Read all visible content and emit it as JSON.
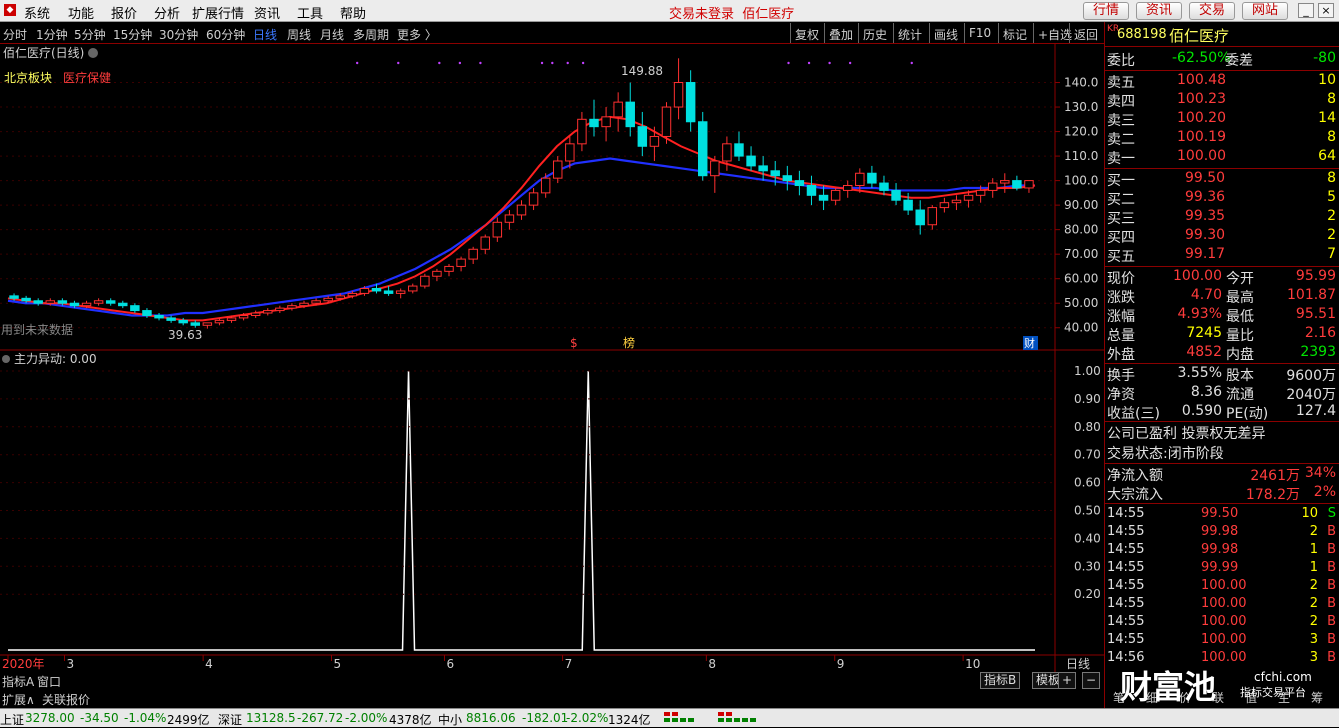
{
  "menubar": {
    "items": [
      "系统",
      "功能",
      "报价",
      "分析",
      "扩展行情",
      "资讯",
      "工具",
      "帮助"
    ],
    "status": "交易未登录",
    "stock_name": "佰仁医疗",
    "buttons": [
      "行情",
      "资讯",
      "交易",
      "网站"
    ]
  },
  "periodbar": {
    "periods": [
      "分时",
      "1分钟",
      "5分钟",
      "15分钟",
      "30分钟",
      "60分钟",
      "日线",
      "周线",
      "月线",
      "多周期",
      "更多 〉"
    ],
    "active": "日线",
    "right": [
      "复权",
      "叠加",
      "历史",
      "统计",
      "画线",
      "F10",
      "标记",
      "+自选",
      "返回"
    ]
  },
  "chart": {
    "title": "佰仁医疗(日线)",
    "sector": "北京板块",
    "sector_tag": "医疗保健",
    "overlay_text": "用到未来数据",
    "high_label": "149.88",
    "low_label": "39.63",
    "event_markers": [
      "$",
      "榜",
      "财"
    ],
    "price_axis": [
      "140.0",
      "130.0",
      "120.0",
      "110.0",
      "100.0",
      "90.00",
      "80.00",
      "70.00",
      "60.00",
      "50.00",
      "40.00"
    ],
    "indicator": {
      "title": "主力异动",
      "value_label": "主力异动: 0.00",
      "axis": [
        "1.00",
        "0.90",
        "0.80",
        "0.70",
        "0.60",
        "0.50",
        "0.40",
        "0.30",
        "0.20"
      ]
    },
    "date_labels": [
      "2020年",
      "3",
      "4",
      "5",
      "6",
      "7",
      "8",
      "9",
      "10"
    ],
    "period_tag": "日线"
  },
  "chart_data": {
    "type": "candlestick",
    "title": "佰仁医疗(日线)",
    "price_range": [
      35,
      150
    ],
    "candles": [
      [
        53,
        54,
        51,
        52
      ],
      [
        52,
        53,
        50,
        51
      ],
      [
        51,
        52,
        49,
        50
      ],
      [
        50,
        52,
        49,
        51
      ],
      [
        51,
        52,
        49,
        50
      ],
      [
        50,
        51,
        48,
        49
      ],
      [
        49,
        51,
        48,
        50
      ],
      [
        50,
        52,
        49,
        51
      ],
      [
        51,
        52,
        49,
        50
      ],
      [
        50,
        51,
        48,
        49
      ],
      [
        49,
        50,
        46,
        47
      ],
      [
        47,
        48,
        44,
        45
      ],
      [
        45,
        46,
        43,
        44
      ],
      [
        44,
        45,
        42,
        43
      ],
      [
        43,
        44,
        41,
        42
      ],
      [
        42,
        43,
        40,
        41
      ],
      [
        41,
        42,
        39.63,
        42
      ],
      [
        42,
        44,
        41,
        43
      ],
      [
        43,
        45,
        42,
        44
      ],
      [
        44,
        46,
        43,
        45
      ],
      [
        45,
        47,
        44,
        46
      ],
      [
        46,
        48,
        45,
        47
      ],
      [
        47,
        49,
        46,
        48
      ],
      [
        48,
        50,
        47,
        49
      ],
      [
        49,
        51,
        48,
        50
      ],
      [
        50,
        52,
        49,
        51
      ],
      [
        51,
        53,
        50,
        52
      ],
      [
        52,
        54,
        51,
        53
      ],
      [
        53,
        55,
        52,
        54
      ],
      [
        54,
        57,
        53,
        56
      ],
      [
        56,
        58,
        54,
        55
      ],
      [
        55,
        57,
        53,
        54
      ],
      [
        54,
        56,
        52,
        55
      ],
      [
        55,
        58,
        54,
        57
      ],
      [
        57,
        62,
        56,
        61
      ],
      [
        61,
        64,
        59,
        63
      ],
      [
        63,
        66,
        61,
        65
      ],
      [
        65,
        69,
        63,
        68
      ],
      [
        68,
        73,
        66,
        72
      ],
      [
        72,
        78,
        70,
        77
      ],
      [
        77,
        85,
        75,
        83
      ],
      [
        83,
        88,
        80,
        86
      ],
      [
        86,
        92,
        84,
        90
      ],
      [
        90,
        97,
        88,
        95
      ],
      [
        95,
        103,
        93,
        101
      ],
      [
        101,
        110,
        99,
        108
      ],
      [
        108,
        118,
        105,
        115
      ],
      [
        115,
        128,
        112,
        125
      ],
      [
        125,
        133,
        118,
        122
      ],
      [
        122,
        130,
        116,
        126
      ],
      [
        126,
        136,
        120,
        132
      ],
      [
        132,
        140,
        118,
        122
      ],
      [
        122,
        128,
        110,
        114
      ],
      [
        114,
        122,
        108,
        118
      ],
      [
        118,
        132,
        115,
        130
      ],
      [
        130,
        149.88,
        125,
        140
      ],
      [
        140,
        145,
        120,
        124
      ],
      [
        124,
        128,
        100,
        102
      ],
      [
        102,
        110,
        95,
        108
      ],
      [
        108,
        118,
        104,
        115
      ],
      [
        115,
        120,
        108,
        110
      ],
      [
        110,
        114,
        104,
        106
      ],
      [
        106,
        110,
        100,
        104
      ],
      [
        104,
        108,
        98,
        102
      ],
      [
        102,
        106,
        96,
        100
      ],
      [
        100,
        104,
        94,
        98
      ],
      [
        98,
        102,
        90,
        94
      ],
      [
        94,
        98,
        88,
        92
      ],
      [
        92,
        97,
        90,
        96
      ],
      [
        96,
        100,
        93,
        98
      ],
      [
        98,
        105,
        95,
        103
      ],
      [
        103,
        106,
        97,
        99
      ],
      [
        99,
        102,
        94,
        96
      ],
      [
        96,
        99,
        90,
        92
      ],
      [
        92,
        95,
        86,
        88
      ],
      [
        88,
        92,
        78,
        82
      ],
      [
        82,
        90,
        80,
        89
      ],
      [
        89,
        93,
        87,
        91
      ],
      [
        91,
        94,
        88,
        92
      ],
      [
        92,
        96,
        89,
        94
      ],
      [
        94,
        98,
        91,
        96
      ],
      [
        96,
        101,
        93,
        99
      ],
      [
        99,
        103,
        95,
        100
      ],
      [
        100,
        102,
        96,
        97
      ],
      [
        97,
        100,
        95,
        100
      ]
    ],
    "ma_short": [
      52,
      51,
      50,
      50,
      49,
      48,
      47,
      46,
      45,
      44,
      43,
      43,
      44,
      45,
      46,
      47,
      48,
      49,
      50,
      52,
      54,
      56,
      58,
      61,
      65,
      70,
      76,
      82,
      89,
      97,
      106,
      114,
      120,
      124,
      126,
      125,
      122,
      118,
      114,
      111,
      108,
      106,
      104,
      102,
      100,
      99,
      98,
      97,
      96,
      95,
      94,
      93,
      93,
      94,
      95,
      96,
      97,
      97,
      98
    ],
    "ma_long": [
      51,
      50,
      50,
      49,
      48,
      47,
      46,
      45,
      45,
      45,
      46,
      46,
      47,
      48,
      49,
      50,
      51,
      52,
      53,
      54,
      56,
      58,
      61,
      64,
      68,
      72,
      77,
      82,
      88,
      94,
      100,
      104,
      107,
      108,
      109,
      108,
      107,
      106,
      105,
      104,
      103,
      102,
      101,
      100,
      99,
      98,
      97,
      97,
      97,
      97,
      96,
      96,
      96,
      96,
      97,
      97,
      97,
      98,
      98
    ],
    "indicator_values": {
      "name": "主力异动",
      "spikes_at_date_fraction": [
        0.39,
        0.565
      ],
      "range": [
        0,
        1
      ]
    }
  },
  "bottombar": {
    "tabs": [
      "指标A",
      "窗口",
      "扩展∧",
      "关联报价"
    ],
    "right_tabs": [
      "指标B",
      "模板",
      "+",
      "−"
    ]
  },
  "statusbar": {
    "items": [
      {
        "name": "上证",
        "value": "3278.00",
        "change": "-34.50",
        "pct": "-1.04%",
        "vol": "2499亿"
      },
      {
        "name": "深证",
        "value": "13128.5",
        "change": "-267.72",
        "pct": "-2.00%",
        "vol": "4378亿"
      },
      {
        "name": "中小",
        "value": "8816.06",
        "change": "-182.01",
        "pct": "-2.02%",
        "vol": "1324亿"
      }
    ]
  },
  "quote": {
    "code": "688198",
    "name": "佰仁医疗",
    "kr": "KR",
    "weibi": {
      "label": "委比",
      "value": "-62.50%",
      "label2": "委差",
      "value2": "-80"
    },
    "sells": [
      {
        "label": "卖五",
        "price": "100.48",
        "vol": "10"
      },
      {
        "label": "卖四",
        "price": "100.23",
        "vol": "8"
      },
      {
        "label": "卖三",
        "price": "100.20",
        "vol": "14"
      },
      {
        "label": "卖二",
        "price": "100.19",
        "vol": "8"
      },
      {
        "label": "卖一",
        "price": "100.00",
        "vol": "64"
      }
    ],
    "buys": [
      {
        "label": "买一",
        "price": "99.50",
        "vol": "8"
      },
      {
        "label": "买二",
        "price": "99.36",
        "vol": "5"
      },
      {
        "label": "买三",
        "price": "99.35",
        "vol": "2"
      },
      {
        "label": "买四",
        "price": "99.30",
        "vol": "2"
      },
      {
        "label": "买五",
        "price": "99.17",
        "vol": "7"
      }
    ],
    "stats": [
      {
        "l1": "现价",
        "v1": "100.00",
        "l2": "今开",
        "v2": "95.99"
      },
      {
        "l1": "涨跌",
        "v1": "4.70",
        "l2": "最高",
        "v2": "101.87"
      },
      {
        "l1": "涨幅",
        "v1": "4.93%",
        "l2": "最低",
        "v2": "95.51"
      },
      {
        "l1": "总量",
        "v1": "7245",
        "l2": "量比",
        "v2": "2.16"
      },
      {
        "l1": "外盘",
        "v1": "4852",
        "l2": "内盘",
        "v2": "2393"
      }
    ],
    "stats2": [
      {
        "l1": "换手",
        "v1": "3.55%",
        "l2": "股本",
        "v2": "9600万"
      },
      {
        "l1": "净资",
        "v1": "8.36",
        "l2": "流通",
        "v2": "2040万"
      },
      {
        "l1": "收益(三)",
        "v1": "0.590",
        "l2": "PE(动)",
        "v2": "127.4"
      }
    ],
    "info1": "公司已盈利 投票权无差异",
    "info2": "交易状态:闭市阶段",
    "flows": [
      {
        "label": "净流入额",
        "value": "2461万",
        "pct": "34%"
      },
      {
        "label": "大宗流入",
        "value": "178.2万",
        "pct": "2%"
      }
    ],
    "ticks": [
      {
        "time": "14:55",
        "price": "99.50",
        "vol": "10",
        "dir": "S"
      },
      {
        "time": "14:55",
        "price": "99.98",
        "vol": "2",
        "dir": "B"
      },
      {
        "time": "14:55",
        "price": "99.98",
        "vol": "1",
        "dir": "B"
      },
      {
        "time": "14:55",
        "price": "99.99",
        "vol": "1",
        "dir": "B"
      },
      {
        "time": "14:55",
        "price": "100.00",
        "vol": "2",
        "dir": "B"
      },
      {
        "time": "14:55",
        "price": "100.00",
        "vol": "2",
        "dir": "B"
      },
      {
        "time": "14:55",
        "price": "100.00",
        "vol": "2",
        "dir": "B"
      },
      {
        "time": "14:55",
        "price": "100.00",
        "vol": "3",
        "dir": "B"
      },
      {
        "time": "14:56",
        "price": "100.00",
        "vol": "3",
        "dir": "B"
      }
    ],
    "bottom_tabs": [
      "笔",
      "细",
      "价",
      "联",
      "值",
      "主",
      "筹"
    ],
    "watermark": "财富池",
    "watermark_url": "cfchi.com",
    "watermark_sub": "指标交易平台"
  }
}
